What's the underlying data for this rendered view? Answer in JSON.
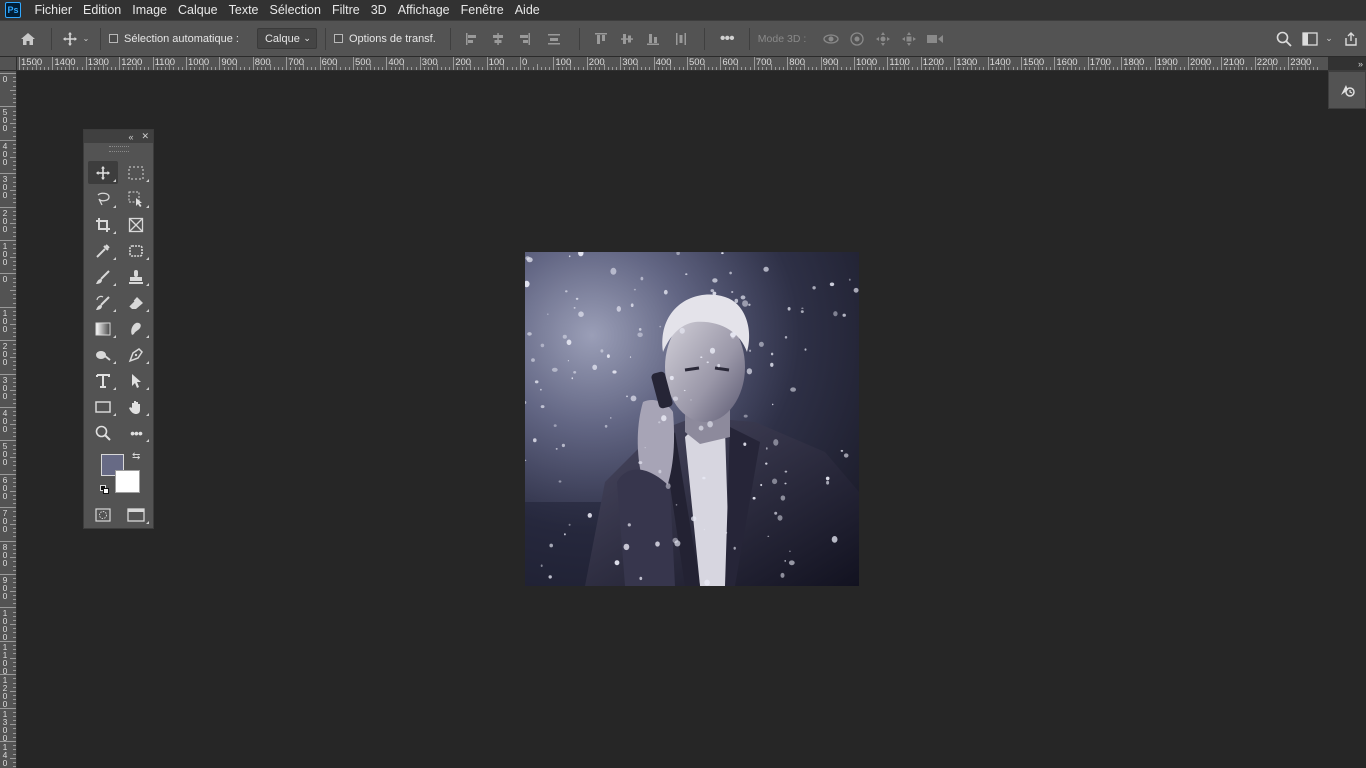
{
  "app": {
    "logo": "Ps"
  },
  "menu": [
    "Fichier",
    "Edition",
    "Image",
    "Calque",
    "Texte",
    "Sélection",
    "Filtre",
    "3D",
    "Affichage",
    "Fenêtre",
    "Aide"
  ],
  "options": {
    "auto_select_label": "Sélection automatique :",
    "auto_select_value": "Calque",
    "transform_label": "Options de transf.",
    "mode3d_label": "Mode 3D :"
  },
  "ruler_h": [
    "1500",
    "1400",
    "1300",
    "1200",
    "1100",
    "1000",
    "900",
    "800",
    "700",
    "600",
    "500",
    "400",
    "300",
    "200",
    "100",
    "0",
    "100",
    "200",
    "300",
    "400",
    "500",
    "600",
    "700",
    "800",
    "900",
    "1000",
    "1100",
    "1200",
    "1300",
    "1400",
    "1500",
    "1600",
    "1700",
    "1800",
    "1900",
    "2000",
    "2100",
    "2200",
    "2300"
  ],
  "ruler_v": [
    "0",
    "5\n0\n0",
    "4\n0\n0",
    "3\n0\n0",
    "2\n0\n0",
    "1\n0\n0",
    "0",
    "1\n0\n0",
    "2\n0\n0",
    "3\n0\n0",
    "4\n0\n0",
    "5\n0\n0",
    "6\n0\n0",
    "7\n0\n0",
    "8\n0\n0",
    "9\n0\n0",
    "1\n0\n0\n0",
    "1\n1\n0\n0",
    "1\n2\n0\n0",
    "1\n3\n0\n0",
    "1\n4\n0\n0"
  ],
  "colors": {
    "foreground": "#676a85",
    "background": "#ffffff",
    "accent": "#31a8ff"
  },
  "toolbar": {
    "tools": [
      "move-tool",
      "rect-marquee-tool",
      "lasso-tool",
      "object-select-tool",
      "crop-tool",
      "frame-tool",
      "eyedropper-tool",
      "patch-tool",
      "brush-tool",
      "stamp-tool",
      "history-brush-tool",
      "eraser-tool",
      "gradient-tool",
      "smudge-tool",
      "dodge-tool",
      "pen-tool",
      "type-tool",
      "path-select-tool",
      "rectangle-tool",
      "hand-tool",
      "zoom-tool",
      "more-tools"
    ]
  }
}
